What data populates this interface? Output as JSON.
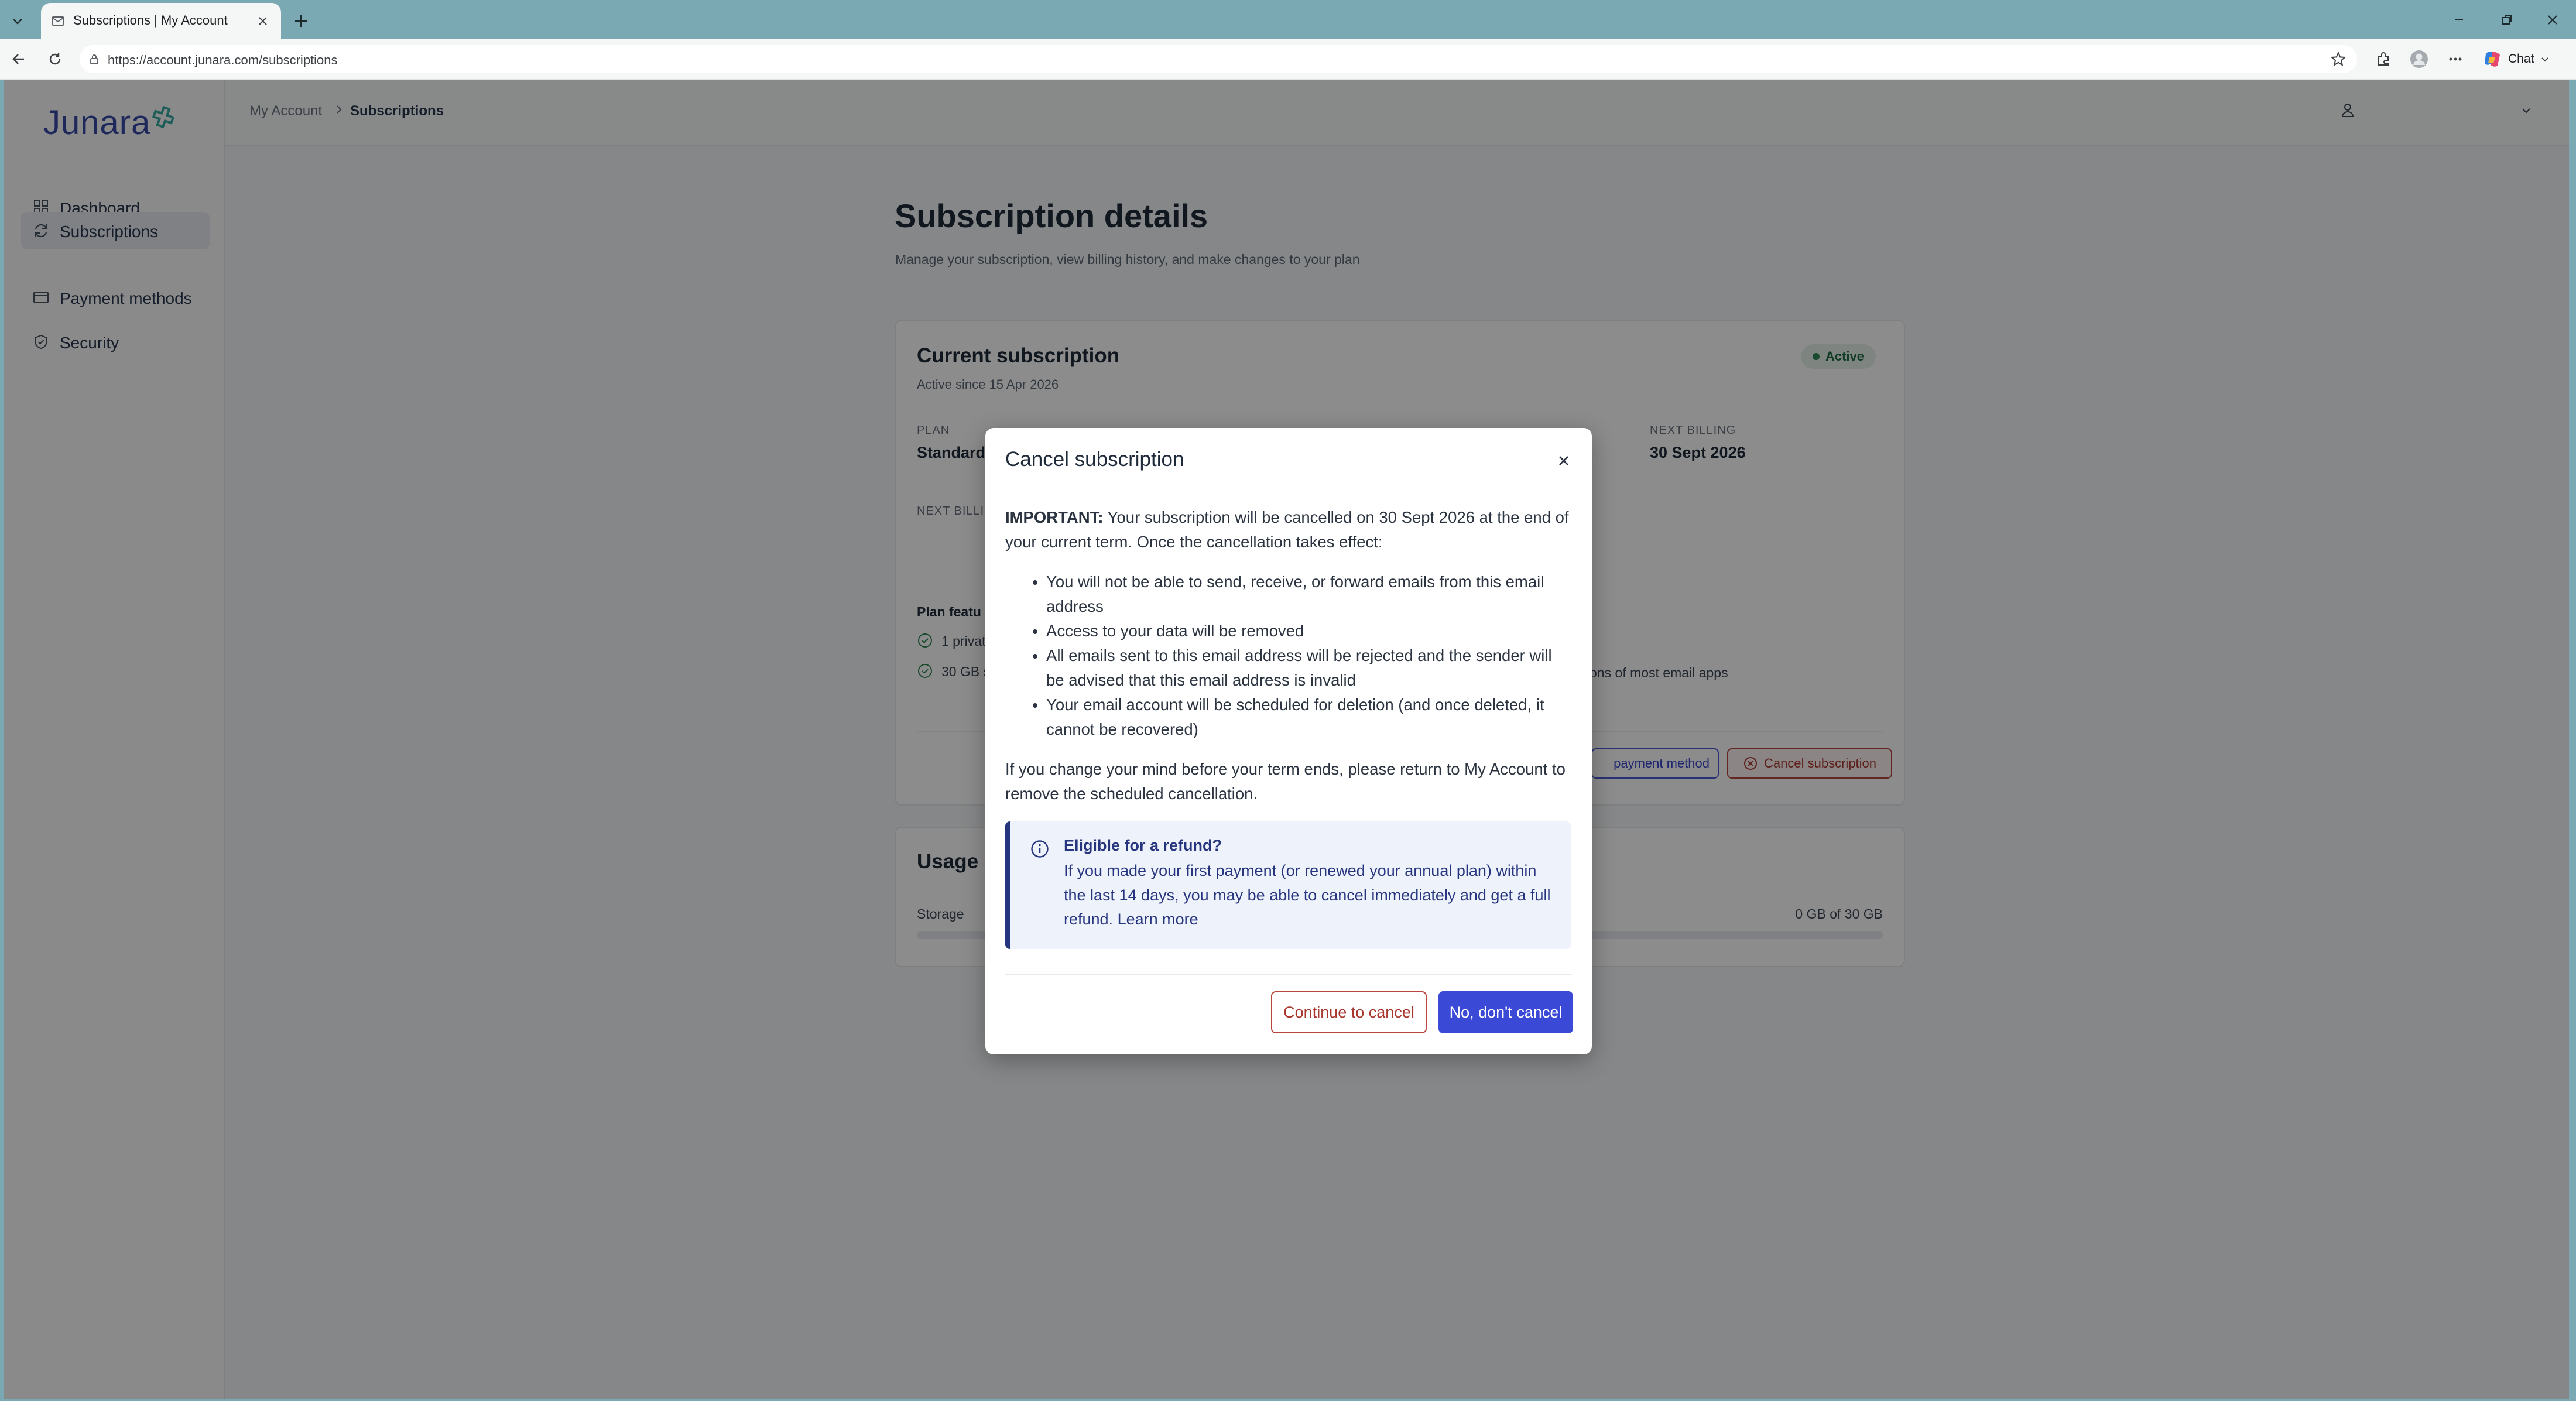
{
  "browser": {
    "tab_title": "Subscriptions | My Account",
    "url": "https://account.junara.com/subscriptions",
    "chat_label": "Chat"
  },
  "app": {
    "logo_text": "Junara",
    "brand_color": "#3949a5",
    "accent_color": "#3b4ad6",
    "danger_color": "#a8372f"
  },
  "sidebar": {
    "items": [
      {
        "label": "Dashboard",
        "icon": "grid-icon",
        "active": false
      },
      {
        "label": "Subscriptions",
        "icon": "refresh-icon",
        "active": true
      },
      {
        "label": "Payment methods",
        "icon": "card-icon",
        "active": false
      },
      {
        "label": "Security",
        "icon": "shield-icon",
        "active": false
      }
    ]
  },
  "header": {
    "breadcrumb_root": "My Account",
    "breadcrumb_current": "Subscriptions"
  },
  "page": {
    "title": "Subscription details",
    "subtitle": "Manage your subscription, view billing history, and make changes to your plan"
  },
  "subscription_card": {
    "title": "Current subscription",
    "active_since": "Active since 15 Apr 2026",
    "status": "Active",
    "plan_label": "PLAN",
    "plan_value": "Standard",
    "next_billing_label": "NEXT BILLING",
    "next_billing_value": "30 Sept 2026",
    "next_billing_label_row2": "NEXT BILLI",
    "features_label": "Plan featu",
    "feature_1": "1 privat",
    "feature_2": "30 GB s",
    "feature_extra": "ersions of most email apps",
    "update_payment_label": "payment method",
    "cancel_label": "Cancel subscription"
  },
  "usage_card": {
    "title": "Usage &",
    "storage_label": "Storage",
    "storage_value": "0 GB of 30 GB",
    "storage_fraction": 0
  },
  "modal": {
    "title": "Cancel subscription",
    "important_label": "IMPORTANT:",
    "important_text": " Your subscription will be cancelled on 30 Sept 2026 at the end of your current term. Once the cancellation takes effect:",
    "bullets": [
      "You will not be able to send, receive, or forward emails from this email address",
      "Access to your data will be removed",
      "All emails sent to this email address will be rejected and the sender will be advised that this email address is invalid",
      "Your email account will be scheduled for deletion (and once deleted, it cannot be recovered)"
    ],
    "change_mind": "If you change your mind before your term ends, please return to My Account to remove the scheduled cancellation.",
    "refund_title": "Eligible for a refund?",
    "refund_text": "If you made your first payment (or renewed your annual plan) within the last 14 days, you may be able to cancel immediately and get a full refund.",
    "refund_link": "Learn more",
    "continue_button": "Continue to cancel",
    "dont_cancel_button": "No, don't cancel"
  }
}
